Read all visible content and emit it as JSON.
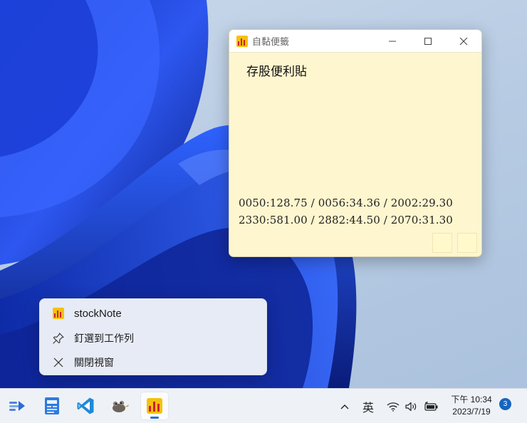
{
  "note_window": {
    "title": "自黏便籤",
    "heading": "存股便利貼",
    "quotes": [
      "0050:128.75 / 0056:34.36 / 2002:29.30",
      "2330:581.00 / 2882:44.50 / 2070:31.30"
    ],
    "icons": {
      "minimize": "minimize-icon",
      "maximize": "maximize-icon",
      "close": "close-icon"
    }
  },
  "jump_list": {
    "items": [
      {
        "label": "stockNote",
        "icon": "stocknote-app-icon"
      },
      {
        "label": "釘選到工作列",
        "icon": "pin-icon"
      },
      {
        "label": "關閉視窗",
        "icon": "close-icon"
      }
    ]
  },
  "taskbar": {
    "apps": [
      "bluesky-app-icon",
      "news-app-icon",
      "vscode-icon",
      "gimp-icon",
      "stocknote-app-icon"
    ],
    "tray": {
      "chevron": "chevron-up-icon",
      "ime": "英",
      "wifi": "wifi-icon",
      "volume": "volume-icon",
      "battery": "battery-icon"
    },
    "clock": {
      "time": "下午 10:34",
      "date": "2023/7/19"
    },
    "notification_count": "3"
  },
  "colors": {
    "note_background": "#fef6cf",
    "accent": "#1f6fd6",
    "wallpaper_blue": "#1a3fd8"
  }
}
